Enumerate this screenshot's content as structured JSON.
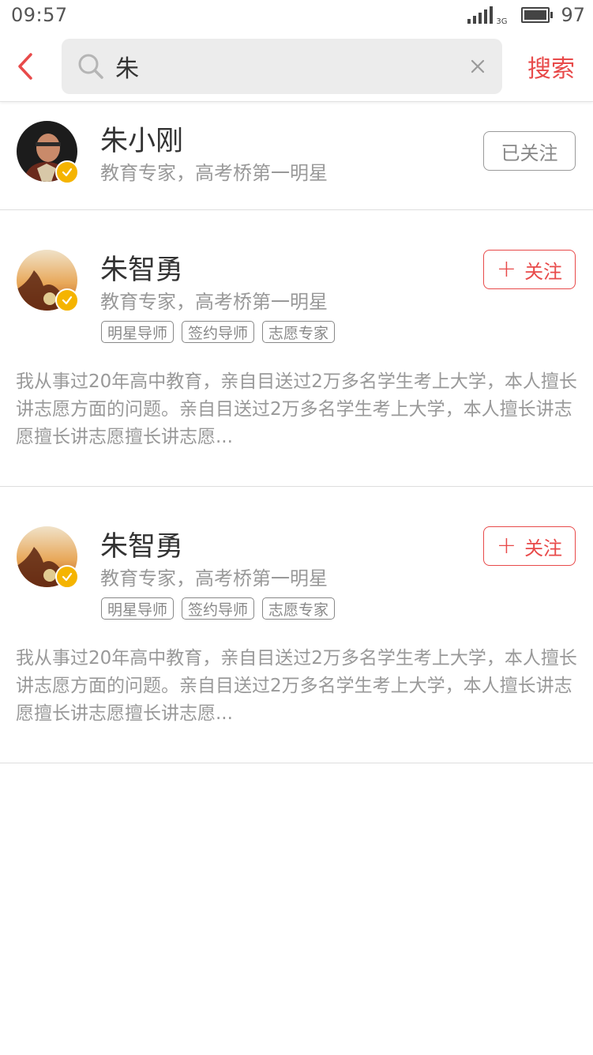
{
  "status": {
    "time": "09:57",
    "network": "3G",
    "battery": "97",
    "battery_level": 0.97
  },
  "search": {
    "query": "朱",
    "button_label": "搜索"
  },
  "results": [
    {
      "name": "朱小刚",
      "intro": "教育专家，高考桥第一明星",
      "follow_label": "已关注",
      "followed": true
    },
    {
      "name": "朱智勇",
      "intro": "教育专家，高考桥第一明星",
      "follow_label": "关注",
      "followed": false,
      "tags": [
        "明星导师",
        "签约导师",
        "志愿专家"
      ],
      "description": "我从事过20年高中教育，亲自目送过2万多名学生考上大学，本人擅长讲志愿方面的问题。亲自目送过2万多名学生考上大学，本人擅长讲志愿擅长讲志愿擅长讲志愿..."
    },
    {
      "name": "朱智勇",
      "intro": "教育专家，高考桥第一明星",
      "follow_label": "关注",
      "followed": false,
      "tags": [
        "明星导师",
        "签约导师",
        "志愿专家"
      ],
      "description": "我从事过20年高中教育，亲自目送过2万多名学生考上大学，本人擅长讲志愿方面的问题。亲自目送过2万多名学生考上大学，本人擅长讲志愿擅长讲志愿擅长讲志愿..."
    }
  ],
  "colors": {
    "accent": "#e84a4a",
    "verified": "#f5b400"
  }
}
